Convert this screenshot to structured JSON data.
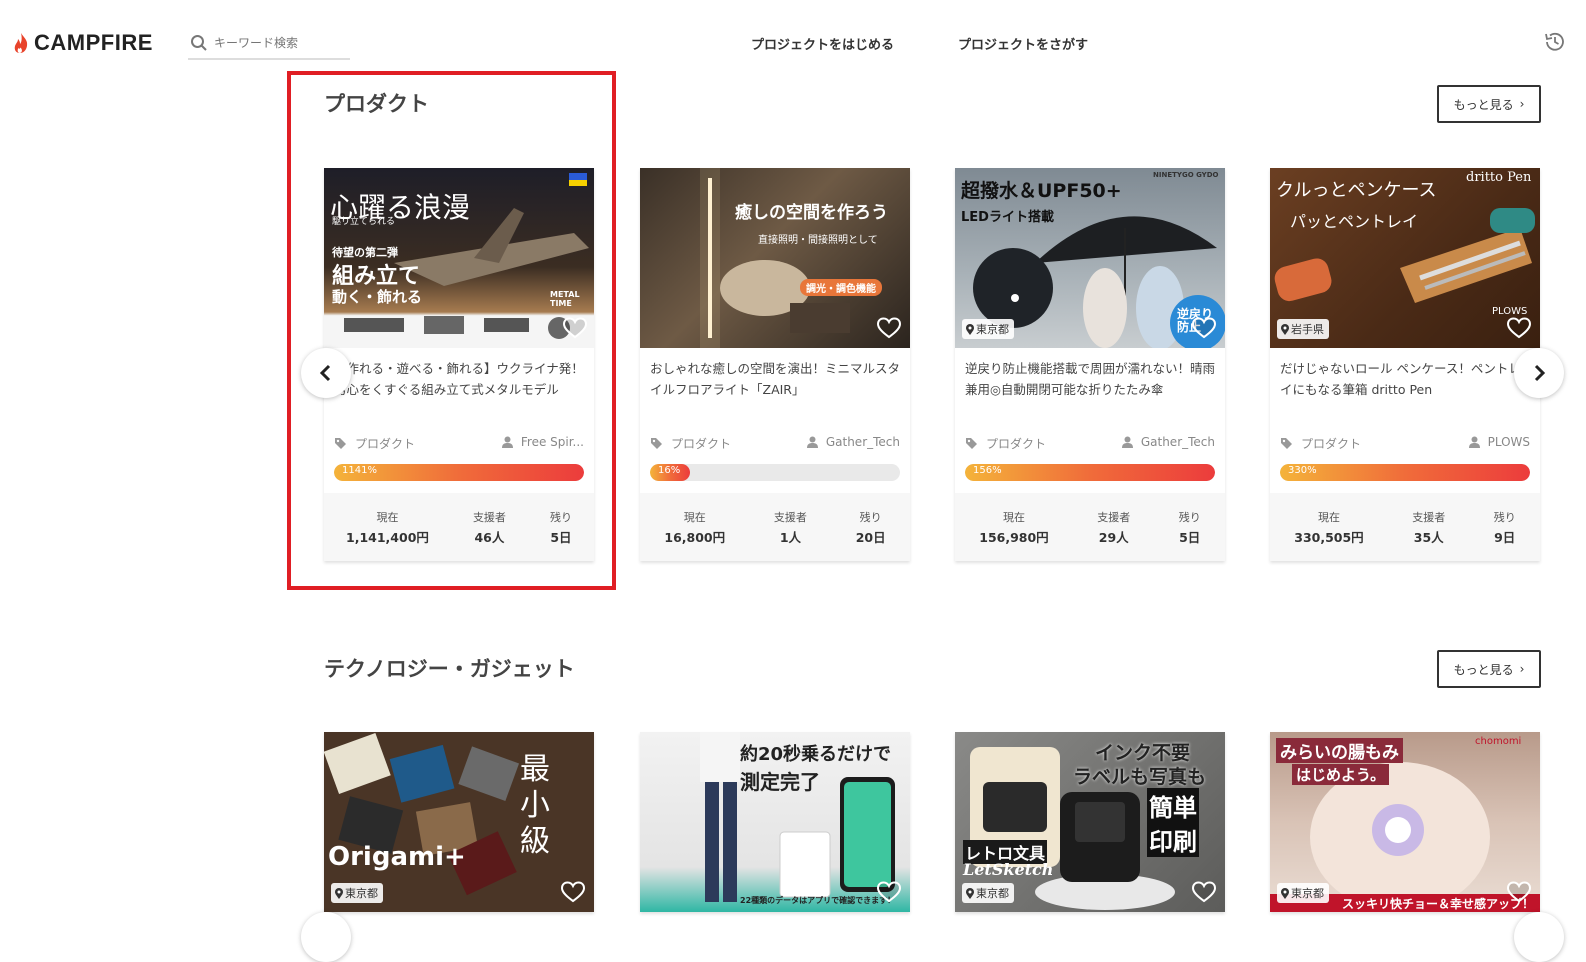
{
  "header": {
    "logo": "CAMPFIRE",
    "search_placeholder": "キーワード検索",
    "nav": [
      "プロジェクトをはじめる",
      "プロジェクトをさがす"
    ]
  },
  "sections": [
    {
      "title": "プロダクト",
      "more_label": "もっと見る",
      "cards": [
        {
          "image_text": [
            "心躍る浪漫",
            "駆り立てられる",
            "待望の第二弾",
            "組み立て",
            "動く・飾れる",
            "METAL TIME"
          ],
          "title": "【作れる・遊べる・飾れる】ウクライナ発！男心をくすぐる組み立て式メタルモデル",
          "category": "プロダクト",
          "owner": "Free Spir...",
          "progress_label": "1141%",
          "progress": 1.0,
          "stats": {
            "current_label": "現在",
            "current": "1,141,400円",
            "backers_label": "支援者",
            "backers": "46人",
            "remaining_label": "残り",
            "remaining": "5日"
          }
        },
        {
          "image_text": [
            "癒しの空間を作ろう",
            "直接照明・間接照明として",
            "調光・調色機能"
          ],
          "title": "おしゃれな癒しの空間を演出！ミニマルスタイルフロアライト「ZAIR」",
          "category": "プロダクト",
          "owner": "Gather_Tech",
          "progress_label": "16%",
          "progress": 0.16,
          "stats": {
            "current_label": "現在",
            "current": "16,800円",
            "backers_label": "支援者",
            "backers": "1人",
            "remaining_label": "残り",
            "remaining": "20日"
          }
        },
        {
          "image_text": [
            "超撥水＆UPF50+",
            "LEDライト搭載",
            "NINETYGO GYDO",
            "逆戻り防止"
          ],
          "location": "東京都",
          "title": "逆戻り防止機能搭載で周囲が濡れない！晴雨兼用◎自動開閉可能な折りたたみ傘",
          "category": "プロダクト",
          "owner": "Gather_Tech",
          "progress_label": "156%",
          "progress": 1.0,
          "stats": {
            "current_label": "現在",
            "current": "156,980円",
            "backers_label": "支援者",
            "backers": "29人",
            "remaining_label": "残り",
            "remaining": "5日"
          }
        },
        {
          "image_text": [
            "クルっとペンケース",
            "パッとペントレイ",
            "dritto Pen",
            "PLOWS"
          ],
          "location": "岩手県",
          "title": "だけじゃないロール ペンケース！ペントレイにもなる筆箱 dritto Pen",
          "category": "プロダクト",
          "owner": "PLOWS",
          "progress_label": "330%",
          "progress": 1.0,
          "stats": {
            "current_label": "現在",
            "current": "330,505円",
            "backers_label": "支援者",
            "backers": "35人",
            "remaining_label": "残り",
            "remaining": "9日"
          }
        }
      ]
    },
    {
      "title": "テクノロジー・ガジェット",
      "more_label": "もっと見る",
      "cards": [
        {
          "image_text": [
            "最小級",
            "Origami+"
          ],
          "location": "東京都"
        },
        {
          "image_text": [
            "約20秒乗るだけで",
            "測定完了",
            "22種類のデータはアプリで確認できます！"
          ]
        },
        {
          "image_text": [
            "インク不要",
            "ラベルも写真も",
            "簡単",
            "印刷",
            "レトロ文具",
            "LetSketch"
          ],
          "location": "東京都"
        },
        {
          "image_text": [
            "みらいの腸もみ",
            "はじめよう。",
            "chomomi",
            "スッキリ快チョー＆幸せ感アップ！"
          ],
          "location": "東京都"
        }
      ]
    }
  ],
  "colors": {
    "accent": "#e01e24",
    "progress_start": "#f4b33a",
    "progress_end": "#ec3c3c"
  },
  "icons": [
    "campfire-flame-icon",
    "search-icon",
    "history-icon",
    "tag-icon",
    "user-icon",
    "heart-icon",
    "location-pin-icon",
    "chevron-left-icon",
    "chevron-right-icon"
  ]
}
